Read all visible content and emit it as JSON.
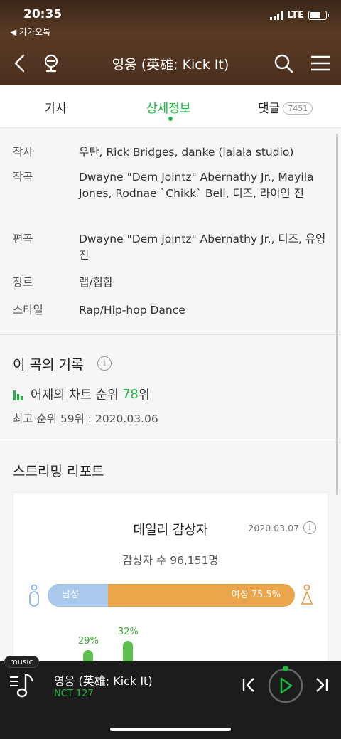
{
  "status": {
    "time": "20:35",
    "back_app": "◀ 카카오톡",
    "network": "LTE"
  },
  "nav": {
    "title": "영웅 (英雄; Kick It)"
  },
  "tabs": [
    {
      "label": "가사"
    },
    {
      "label": "상세정보"
    },
    {
      "label": "댓글",
      "badge": "7451"
    }
  ],
  "details": [
    {
      "key": "작사",
      "value": "우탄, Rick Bridges, danke (lalala studio)"
    },
    {
      "key": "작곡",
      "value": "Dwayne \"Dem Jointz\" Abernathy Jr., Mayila Jones, Rodnae `Chikk` Bell, 디즈, 라이언 전"
    },
    {
      "key": "편곡",
      "value": "Dwayne \"Dem Jointz\" Abernathy Jr., 디즈, 유영진"
    },
    {
      "key": "장르",
      "value": "랩/힙합"
    },
    {
      "key": "스타일",
      "value": "Rap/Hip-hop Dance"
    }
  ],
  "record": {
    "title": "이 곡의 기록",
    "chart_prefix": "어제의 차트 순위",
    "chart_rank": "78",
    "chart_suffix": "위",
    "best": "최고 순위 59위 : 2020.03.06"
  },
  "streaming": {
    "title": "스트리밍 리포트",
    "card_title": "데일리 감상자",
    "date": "2020.03.07",
    "listeners": "감상자 수 96,151명",
    "male_label": "남성 24.5%",
    "female_label": "여성 75.5%",
    "male_pct": 24.5,
    "bars": [
      {
        "label": "29%",
        "value": 29
      },
      {
        "label": "32%",
        "value": 32
      }
    ]
  },
  "player": {
    "tag": "music",
    "song": "영웅 (英雄; Kick It)",
    "artist": "NCT 127"
  },
  "colors": {
    "accent": "#1ab93f",
    "male": "#a9c8ec",
    "female": "#eba54a"
  }
}
